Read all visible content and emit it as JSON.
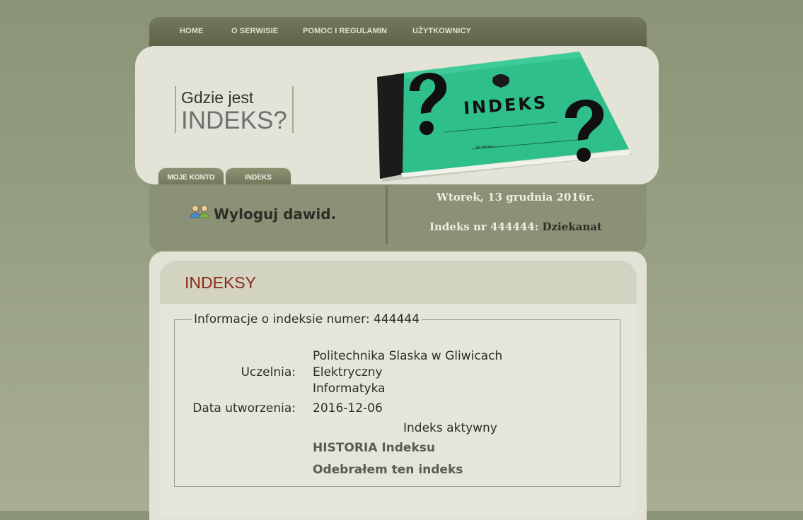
{
  "nav": {
    "items": [
      "HOME",
      "O SERWISIE",
      "POMOC I REGULAMIN",
      "UŻYTKOWNICY"
    ]
  },
  "header": {
    "logo_line1": "Gdzie jest",
    "logo_line2": "INDEKS?",
    "book_title": "INDEKS",
    "book_sub": "Nr albumu",
    "tabs": [
      "MOJE KONTO",
      "INDEKS"
    ]
  },
  "infobar": {
    "logout_text": "Wyloguj dawid.",
    "date": "Wtorek, 13 grudnia 2016r.",
    "index_prefix": "Indeks nr 444444:",
    "index_role": "Dziekanat"
  },
  "panel": {
    "title": "INDEKSY",
    "legend": "Informacje o indeksie numer: 444444",
    "uczelnia_label": "Uczelnia:",
    "uczelnia_values": [
      "Politechnika Slaska w Gliwicach",
      "Elektryczny",
      "Informatyka"
    ],
    "data_label": "Data utworzenia:",
    "data_value": "2016-12-06",
    "status": "Indeks aktywny",
    "history_link": "HISTORIA Indeksu",
    "received_link": "Odebrałem ten indeks"
  },
  "colors": {
    "accent_title": "#8c2a1a",
    "book_green": "#2fc38c"
  },
  "icons": [
    "users-icon",
    "question-mark-icon",
    "eagle-emblem-icon"
  ]
}
